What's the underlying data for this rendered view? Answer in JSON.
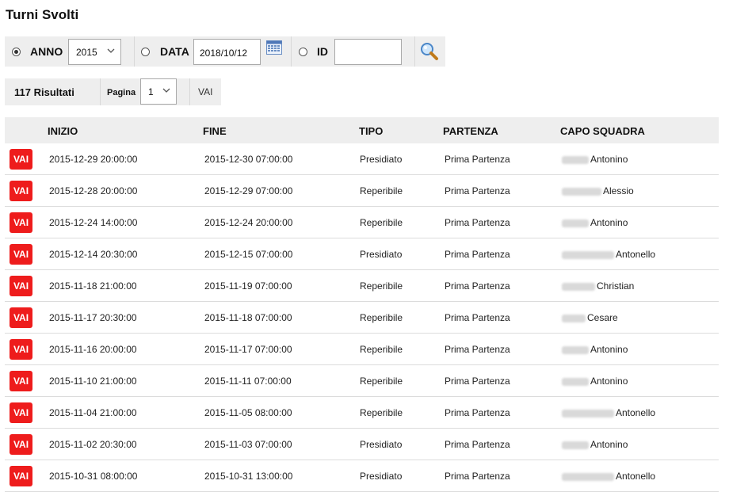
{
  "page": {
    "title": "Turni Svolti"
  },
  "filters": {
    "anno": {
      "label": "ANNO",
      "selected": true,
      "value": "2015"
    },
    "data": {
      "label": "DATA",
      "selected": false,
      "value": "2018/10/12"
    },
    "id": {
      "label": "ID",
      "selected": false,
      "value": ""
    },
    "icons": {
      "calendar": "calendar-icon",
      "search": "magnifier-search-icon"
    }
  },
  "pagination": {
    "results": "117 Risultati",
    "page_label": "Pagina",
    "page_value": "1",
    "go_label": "VAI"
  },
  "table": {
    "columns": [
      "INIZIO",
      "FINE",
      "TIPO",
      "PARTENZA",
      "CAPO SQUADRA"
    ],
    "button_label": "VAI",
    "button_color": "#ee1c1c",
    "rows": [
      {
        "inizio": "2015-12-29 20:00:00",
        "fine": "2015-12-30 07:00:00",
        "tipo": "Presidiato",
        "partenza": "Prima Partenza",
        "capo": "Antonino"
      },
      {
        "inizio": "2015-12-28 20:00:00",
        "fine": "2015-12-29 07:00:00",
        "tipo": "Reperibile",
        "partenza": "Prima Partenza",
        "capo": "Alessio"
      },
      {
        "inizio": "2015-12-24 14:00:00",
        "fine": "2015-12-24 20:00:00",
        "tipo": "Reperibile",
        "partenza": "Prima Partenza",
        "capo": "Antonino"
      },
      {
        "inizio": "2015-12-14 20:30:00",
        "fine": "2015-12-15 07:00:00",
        "tipo": "Presidiato",
        "partenza": "Prima Partenza",
        "capo": "Antonello"
      },
      {
        "inizio": "2015-11-18 21:00:00",
        "fine": "2015-11-19 07:00:00",
        "tipo": "Reperibile",
        "partenza": "Prima Partenza",
        "capo": "Christian"
      },
      {
        "inizio": "2015-11-17 20:30:00",
        "fine": "2015-11-18 07:00:00",
        "tipo": "Reperibile",
        "partenza": "Prima Partenza",
        "capo": "Cesare"
      },
      {
        "inizio": "2015-11-16 20:00:00",
        "fine": "2015-11-17 07:00:00",
        "tipo": "Reperibile",
        "partenza": "Prima Partenza",
        "capo": "Antonino"
      },
      {
        "inizio": "2015-11-10 21:00:00",
        "fine": "2015-11-11 07:00:00",
        "tipo": "Reperibile",
        "partenza": "Prima Partenza",
        "capo": "Antonino"
      },
      {
        "inizio": "2015-11-04 21:00:00",
        "fine": "2015-11-05 08:00:00",
        "tipo": "Reperibile",
        "partenza": "Prima Partenza",
        "capo": "Antonello"
      },
      {
        "inizio": "2015-11-02 20:30:00",
        "fine": "2015-11-03 07:00:00",
        "tipo": "Presidiato",
        "partenza": "Prima Partenza",
        "capo": "Antonino"
      },
      {
        "inizio": "2015-10-31 08:00:00",
        "fine": "2015-10-31 13:00:00",
        "tipo": "Presidiato",
        "partenza": "Prima Partenza",
        "capo": "Antonello"
      }
    ]
  }
}
